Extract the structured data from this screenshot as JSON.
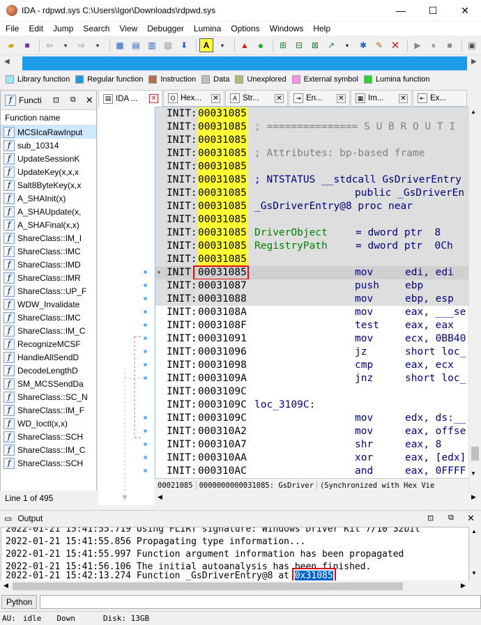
{
  "window": {
    "title": "IDA - rdpwd.sys C:\\Users\\Igor\\Downloads\\rdpwd.sys",
    "minimize": "—",
    "maximize": "☐",
    "close": "✕"
  },
  "menu": [
    "File",
    "Edit",
    "Jump",
    "Search",
    "View",
    "Debugger",
    "Lumina",
    "Options",
    "Windows",
    "Help"
  ],
  "legend": [
    {
      "label": "Library function",
      "color": "#9ee8f8"
    },
    {
      "label": "Regular function",
      "color": "#1e9be8"
    },
    {
      "label": "Instruction",
      "color": "#b07050"
    },
    {
      "label": "Data",
      "color": "#c0c0c0"
    },
    {
      "label": "Unexplored",
      "color": "#b8b878"
    },
    {
      "label": "External symbol",
      "color": "#ff90f0"
    },
    {
      "label": "Lumina function",
      "color": "#30d030"
    }
  ],
  "functions_panel": {
    "title": "Functi",
    "column": "Function name",
    "items": [
      "MCSIcaRawInput",
      "sub_10314",
      "UpdateSessionK",
      "UpdateKey(x,x,x",
      "Salt8ByteKey(x,x",
      "A_SHAInit(x)",
      "A_SHAUpdate(x,",
      "A_SHAFinal(x,x)",
      "ShareClass::IM_I",
      "ShareClass::IMC",
      "ShareClass::IMD",
      "ShareClass::IMR",
      "ShareClass::UP_F",
      "WDW_Invalidate",
      "ShareClass::IMC",
      "ShareClass::IM_C",
      "RecognizeMCSF",
      "HandleAllSendD",
      "DecodeLengthD",
      "SM_MCSSendDa",
      "ShareClass::SC_N",
      "ShareClass::IM_F",
      "WD_Ioctl(x,x)",
      "ShareClass::SCH",
      "ShareClass::IM_C",
      "ShareClass::SCH"
    ],
    "status": "Line 1 of 495"
  },
  "tabs": [
    {
      "label": "IDA ...",
      "icon": "📄"
    },
    {
      "label": "Hex...",
      "icon": "O"
    },
    {
      "label": "Str...",
      "icon": "A"
    },
    {
      "label": "En...",
      "icon": "⇥"
    },
    {
      "label": "Im...",
      "icon": "▦"
    },
    {
      "label": "Ex...",
      "icon": "⇤"
    }
  ],
  "disasm": {
    "lines": [
      {
        "seg": "INIT:",
        "addr": "00031085",
        "yellow": true,
        "kind": "blank"
      },
      {
        "seg": "INIT:",
        "addr": "00031085",
        "yellow": true,
        "kind": "cmt",
        "text": "; =============== S U B R O U T I"
      },
      {
        "seg": "INIT:",
        "addr": "00031085",
        "yellow": true,
        "kind": "blank"
      },
      {
        "seg": "INIT:",
        "addr": "00031085",
        "yellow": true,
        "kind": "cmt",
        "text": "; Attributes: bp-based frame"
      },
      {
        "seg": "INIT:",
        "addr": "00031085",
        "yellow": true,
        "kind": "blank"
      },
      {
        "seg": "INIT:",
        "addr": "00031085",
        "yellow": true,
        "kind": "lbl",
        "text": "; NTSTATUS __stdcall GsDriverEntry"
      },
      {
        "seg": "INIT:",
        "addr": "00031085",
        "yellow": true,
        "kind": "dir",
        "text": "public _GsDriverEn"
      },
      {
        "seg": "INIT:",
        "addr": "00031085",
        "yellow": true,
        "kind": "lbl",
        "text": "_GsDriverEntry@8 proc near"
      },
      {
        "seg": "INIT:",
        "addr": "00031085",
        "yellow": true,
        "kind": "blank"
      },
      {
        "seg": "INIT:",
        "addr": "00031085",
        "yellow": true,
        "kind": "arg",
        "name": "DriverObject",
        "val": "= dword ptr  8"
      },
      {
        "seg": "INIT:",
        "addr": "00031085",
        "yellow": true,
        "kind": "arg",
        "name": "RegistryPath",
        "val": "= dword ptr  0Ch"
      },
      {
        "seg": "INIT:",
        "addr": "00031085",
        "yellow": true,
        "kind": "blank"
      },
      {
        "seg": "INIT:",
        "addr": "00031085",
        "yellow": false,
        "kind": "ins",
        "mnem": "mov",
        "ops": "edi, edi",
        "current": true
      },
      {
        "seg": "INIT:",
        "addr": "00031087",
        "yellow": false,
        "kind": "ins",
        "mnem": "push",
        "ops": "ebp"
      },
      {
        "seg": "INIT:",
        "addr": "00031088",
        "yellow": false,
        "kind": "ins",
        "mnem": "mov",
        "ops": "ebp, esp"
      },
      {
        "seg": "INIT:",
        "addr": "0003108A",
        "yellow": false,
        "kind": "ins",
        "mnem": "mov",
        "ops": "eax, ___se"
      },
      {
        "seg": "INIT:",
        "addr": "0003108F",
        "yellow": false,
        "kind": "ins",
        "mnem": "test",
        "ops": "eax, eax"
      },
      {
        "seg": "INIT:",
        "addr": "00031091",
        "yellow": false,
        "kind": "ins",
        "mnem": "mov",
        "ops": "ecx, 0BB40"
      },
      {
        "seg": "INIT:",
        "addr": "00031096",
        "yellow": false,
        "kind": "ins",
        "mnem": "jz",
        "ops": "short loc_"
      },
      {
        "seg": "INIT:",
        "addr": "00031098",
        "yellow": false,
        "kind": "ins",
        "mnem": "cmp",
        "ops": "eax, ecx"
      },
      {
        "seg": "INIT:",
        "addr": "0003109A",
        "yellow": false,
        "kind": "ins",
        "mnem": "jnz",
        "ops": "short loc_"
      },
      {
        "seg": "INIT:",
        "addr": "0003109C",
        "yellow": false,
        "kind": "blank"
      },
      {
        "seg": "INIT:",
        "addr": "0003109C",
        "yellow": false,
        "kind": "lbl",
        "text": "loc_3109C:"
      },
      {
        "seg": "INIT:",
        "addr": "0003109C",
        "yellow": false,
        "kind": "ins",
        "mnem": "mov",
        "ops": "edx, ds:__"
      },
      {
        "seg": "INIT:",
        "addr": "000310A2",
        "yellow": false,
        "kind": "ins",
        "mnem": "mov",
        "ops": "eax, offse"
      },
      {
        "seg": "INIT:",
        "addr": "000310A7",
        "yellow": false,
        "kind": "ins",
        "mnem": "shr",
        "ops": "eax, 8"
      },
      {
        "seg": "INIT:",
        "addr": "000310AA",
        "yellow": false,
        "kind": "ins",
        "mnem": "xor",
        "ops": "eax, [edx]"
      },
      {
        "seg": "INIT:",
        "addr": "000310AC",
        "yellow": false,
        "kind": "ins",
        "mnem": "and",
        "ops": "eax, 0FFFF"
      }
    ],
    "status_offset": "00021085",
    "status_addr": "0000000000031085: GsDriver",
    "status_sync": "(Synchronized with Hex Vie"
  },
  "output": {
    "title": "Output",
    "lines": [
      "2022-01-21 15:41:55.719 Using FLIRT signature: Windows Driver Kit 7/10 32bit",
      "2022-01-21 15:41:55.856 Propagating type information...",
      "2022-01-21 15:41:55.997 Function argument information has been propagated",
      "2022-01-21 15:41:56.106 The initial autoanalysis has been finished.",
      "2022-01-21 15:42:13.274 Function _GsDriverEntry@8 at "
    ],
    "last_link": "0x31085"
  },
  "command": {
    "button": "Python",
    "value": ""
  },
  "status": {
    "au": "AU:",
    "state": "idle",
    "dir": "Down",
    "disk": "Disk: 13GB"
  }
}
